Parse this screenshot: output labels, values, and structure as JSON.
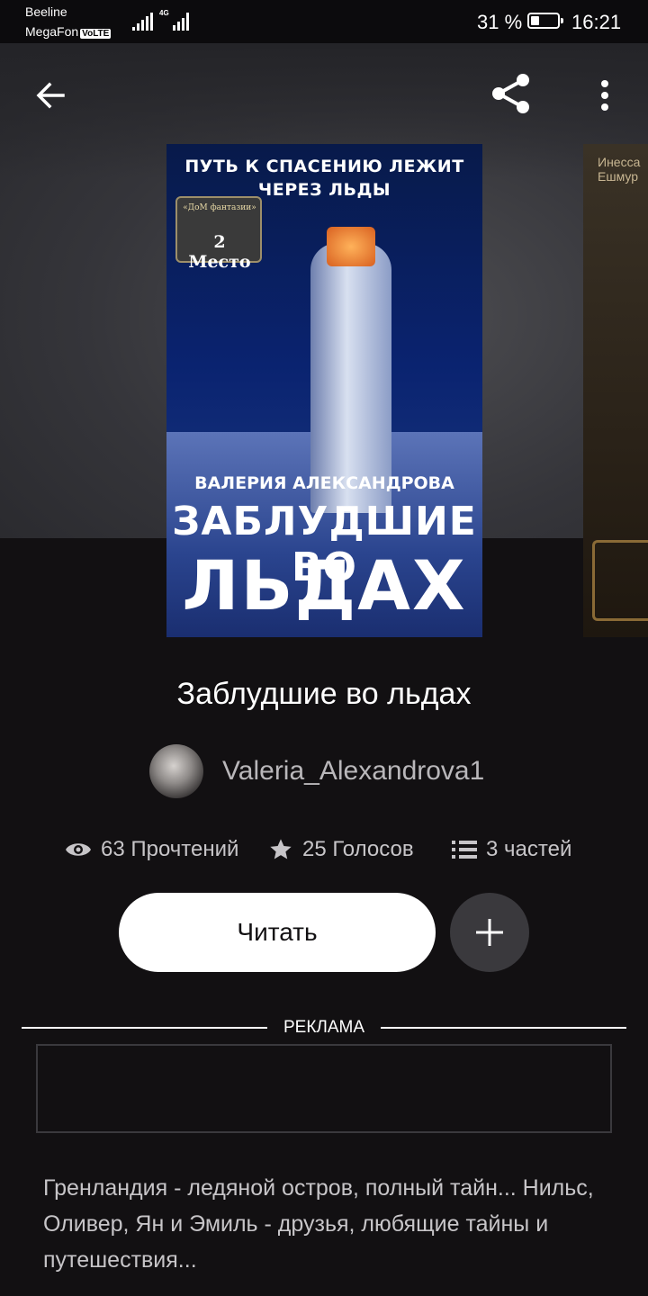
{
  "status_bar": {
    "carrier1": "Beeline",
    "carrier2": "MegaFon",
    "volte": "VoLTE",
    "network": "4G",
    "battery_percent": "31 %",
    "battery_level": 0.31,
    "time": "16:21"
  },
  "toolbar": {
    "back_icon": "arrow-left-icon",
    "share_icon": "share-icon",
    "more_icon": "more-vertical-icon"
  },
  "cover": {
    "top_text": "ПУТЬ К СПАСЕНИЮ ЛЕЖИТ ЧЕРЕЗ ЛЬДЫ",
    "badge_small": "«ДоМ фантазии»",
    "badge_big": "2 Место",
    "author": "ВАЛЕРИЯ АЛЕКСАНДРОВА",
    "title_line1": "ЗАБЛУДШИЕ ВО",
    "title_line2": "ЛЬДАХ"
  },
  "next_cover": {
    "text_line1": "Инесса",
    "text_line2": "Ешмур"
  },
  "book": {
    "title": "Заблудшие во льдах",
    "author": "Valeria_Alexandrova1",
    "reads": "63 Прочтений",
    "votes": "25 Голосов",
    "parts": "3 частей"
  },
  "actions": {
    "read_label": "Читать",
    "add_label": "+"
  },
  "ad": {
    "label": "РЕКЛАМА"
  },
  "description": "Гренландия - ледяной остров, полный тайн... Нильс, Оливер, Ян и Эмиль - друзья, любящие тайны и путешествия...",
  "colors": {
    "background": "#121012",
    "read_button": "#ffffff",
    "add_button": "#3a393d",
    "text_secondary": "#c7c5c8"
  }
}
